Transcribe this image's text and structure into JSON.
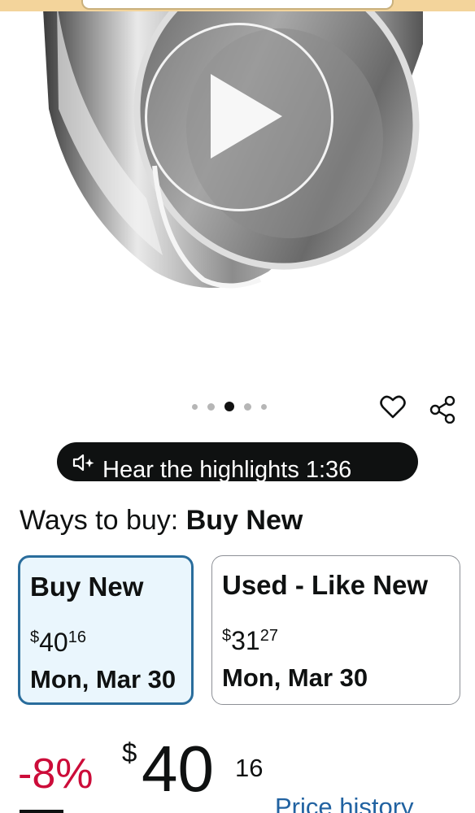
{
  "hero": {
    "video_icon": "play-icon"
  },
  "carousel": {
    "dot_count": 5,
    "active_index": 2
  },
  "icons": {
    "wishlist": "heart-icon",
    "share": "share-icon",
    "audio": "speaker-sparkle-icon"
  },
  "highlights": {
    "label": "Hear the highlights 1:36"
  },
  "ways_to_buy": {
    "prefix": "Ways to buy:",
    "selected": "Buy New",
    "options": [
      {
        "title": "Buy New",
        "currency": "$",
        "whole": "40",
        "cents": "16",
        "delivery": "Mon, Mar 30",
        "selected": true
      },
      {
        "title": "Used - Like New",
        "currency": "$",
        "whole": "31",
        "cents": "27",
        "delivery": "Mon, Mar 30",
        "selected": false
      }
    ]
  },
  "price": {
    "discount": "-8%",
    "currency": "$",
    "whole": "40",
    "cents": "16",
    "history_link": "Price history"
  },
  "colors": {
    "discount": "#cc0c39",
    "link": "#2162a1",
    "selected_border": "#2a6d9c",
    "selected_bg": "#eaf6fd",
    "pill_bg": "#0f1111",
    "header": "#f3d49b"
  }
}
